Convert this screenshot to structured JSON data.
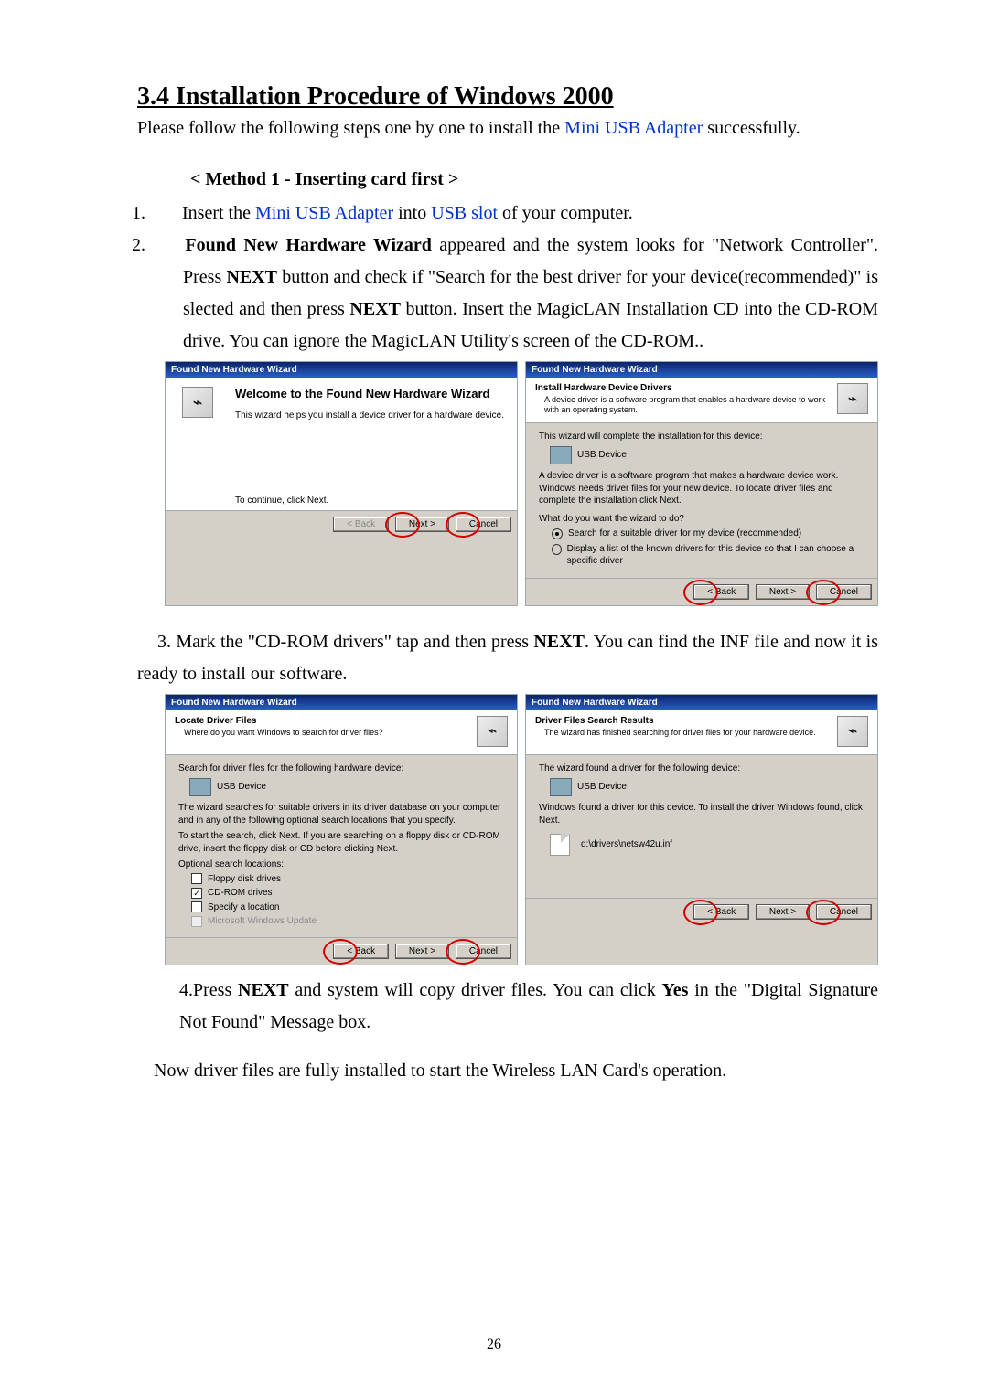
{
  "page_number": "26",
  "heading": "3.4 Installation Procedure of Windows 2000",
  "lead_prefix": "Please follow the following steps one by one to install the ",
  "mini_usb": "Mini USB Adapter",
  "lead_suffix": " successfully.",
  "subhead": "< Method 1 - Inserting card first >",
  "step1_prefix": "Insert the ",
  "step1_mid": " into ",
  "usb_slot": "USB slot",
  "step1_suffix": " of your computer.",
  "step2_bold1": "Found New Hardware Wizard",
  "step2_a": " appeared and the system looks for \"Network Controller\". Press ",
  "step2_bold2": "NEXT",
  "step2_b": " button and check if \"Search for the best driver for your device(recommended)\" is slected and then press ",
  "step2_bold3": "NEXT",
  "step2_c": " button. Insert the MagicLAN Installation CD into the CD-ROM drive. You can ignore the MagicLAN Utility's screen of the CD-ROM..",
  "step3_a": "3. Mark the \"CD-ROM drivers\" tap and then press ",
  "step3_bold": "NEXT",
  "step3_b": ". You can find the INF file and now it is ready to install our software.",
  "step4_a": "4.Press ",
  "step4_bold1": "NEXT",
  "step4_b": " and system will copy driver files. You can click ",
  "step4_bold2": "Yes",
  "step4_c": " in the \"Digital Signature Not Found\" Message box.",
  "closing": "Now driver files are fully installed to start the Wireless LAN Card's operation.",
  "wiz": {
    "title": "Found New Hardware Wizard",
    "btn_back": "< Back",
    "btn_next": "Next >",
    "btn_cancel": "Cancel",
    "welcome": {
      "title": "Welcome to the Found New Hardware Wizard",
      "body1": "This wizard helps you install a device driver for a hardware device.",
      "body2": "To continue, click Next."
    },
    "install_drivers": {
      "banner_title": "Install Hardware Device Drivers",
      "banner_sub": "A device driver is a software program that enables a hardware device to work with an operating system.",
      "line1": "This wizard will complete the installation for this device:",
      "device": "USB Device",
      "line2": "A device driver is a software program that makes a hardware device work. Windows needs driver files for your new device. To locate driver files and complete the installation click Next.",
      "question": "What do you want the wizard to do?",
      "opt1": "Search for a suitable driver for my device (recommended)",
      "opt2": "Display a list of the known drivers for this device so that I can choose a specific driver"
    },
    "locate": {
      "banner_title": "Locate Driver Files",
      "banner_sub": "Where do you want Windows to search for driver files?",
      "line1": "Search for driver files for the following hardware device:",
      "device": "USB Device",
      "line2": "The wizard searches for suitable drivers in its driver database on your computer and in any of the following optional search locations that you specify.",
      "line3": "To start the search, click Next. If you are searching on a floppy disk or CD-ROM drive, insert the floppy disk or CD before clicking Next.",
      "opt_label": "Optional search locations:",
      "opt_floppy": "Floppy disk drives",
      "opt_cd": "CD-ROM drives",
      "opt_spec": "Specify a location",
      "opt_wu": "Microsoft Windows Update"
    },
    "results": {
      "banner_title": "Driver Files Search Results",
      "banner_sub": "The wizard has finished searching for driver files for your hardware device.",
      "line1": "The wizard found a driver for the following device:",
      "device": "USB Device",
      "line2": "Windows found a driver for this device. To install the driver Windows found, click Next.",
      "path": "d:\\drivers\\netsw42u.inf"
    }
  }
}
